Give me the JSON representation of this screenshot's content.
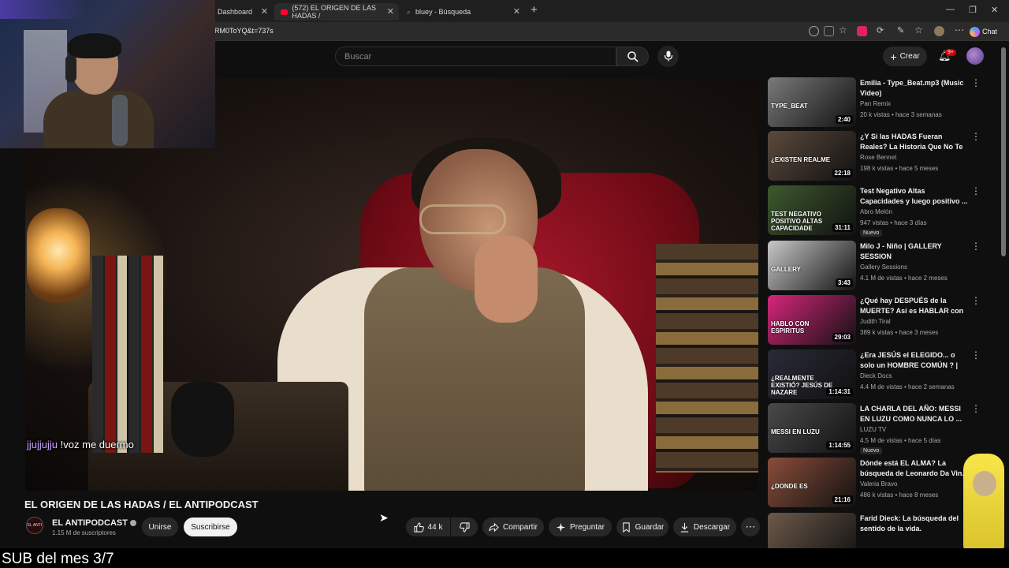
{
  "browser": {
    "tabs": [
      {
        "label": "Dashboard"
      },
      {
        "label": "(572) EL ORIGEN DE LAS HADAS /"
      },
      {
        "label": "bluey - Búsqueda"
      }
    ],
    "url": "RM0ToYQ&t=737s",
    "chat_label": "Chat"
  },
  "header": {
    "search_placeholder": "Buscar",
    "create_label": "Crear",
    "notifications_badge": "9+"
  },
  "player": {
    "chat_user": "jjujjujju",
    "chat_message": "!voz me duermo"
  },
  "video": {
    "title": "EL ORIGEN DE LAS HADAS / EL ANTIPODCAST",
    "channel": "EL ANTIPODCAST",
    "channel_avatar_text": "EL ANTI",
    "subscribers": "1.15 M de suscriptores",
    "join_label": "Unirse",
    "subscribe_label": "Suscribirse",
    "likes": "44 k",
    "share_label": "Compartir",
    "ask_label": "Preguntar",
    "save_label": "Guardar",
    "download_label": "Descargar"
  },
  "recommendations": [
    {
      "title": "Emilia - Type_Beat.mp3 (Music Video)",
      "channel": "Pan Remix",
      "meta": "20 k vistas • hace 3 semanas",
      "duration": "2:40",
      "thumb_color": "#7a7a7a",
      "thumb_text": "TYPE_BEAT"
    },
    {
      "title": "¿Y Si las HADAS Fueran Reales? La Historia Que No Te Contaron",
      "channel": "Rose Bennet",
      "meta": "198 k vistas • hace 5 meses",
      "duration": "22:18",
      "thumb_color": "#5b4a3d",
      "thumb_text": "¿EXISTEN REALME"
    },
    {
      "title": "Test Negativo Altas Capacidades y luego positivo ...",
      "channel": "Abro Melón",
      "meta": "947 vistas • hace 3 días",
      "duration": "31:11",
      "badge": "Nuevo",
      "thumb_color": "#3e5a2e",
      "thumb_text": "TEST NEGATIVO POSITIVO ALTAS CAPACIDADE"
    },
    {
      "title": "Milo J - Niño | GALLERY SESSION",
      "channel": "Gallery Sessions",
      "meta": "4.1 M de vistas • hace 2 meses",
      "duration": "3:43",
      "thumb_color": "#c8c8c8",
      "thumb_text": "GALLERY"
    },
    {
      "title": "¿Qué hay DESPUÉS de la MUERTE? Así es HABLAR con ...",
      "channel": "Judith Tiral",
      "meta": "389 k vistas • hace 3 meses",
      "duration": "29:03",
      "thumb_color": "#d6267a",
      "thumb_text": "HABLO CON ESPIRITUS"
    },
    {
      "title": "¿Era JESÚS el ELEGIDO... o solo un HOMBRE COMÚN ? | Jesús ...",
      "channel": "Dieck Docs",
      "meta": "4.4 M de vistas • hace 2 semanas",
      "duration": "1:14:31",
      "thumb_color": "#2a2a38",
      "thumb_text": "¿REALMENTE EXISTIÓ? JESÚS DE NAZARE"
    },
    {
      "title": "LA CHARLA DEL AÑO: MESSI EN LUZU COMO NUNCA LO ...",
      "channel": "LUZU TV",
      "meta": "4.5 M de vistas • hace 5 días",
      "duration": "1:14:55",
      "badge": "Nuevo",
      "thumb_color": "#4a4a4a",
      "thumb_text": "MESSI EN LUZU"
    },
    {
      "title": "Dónde está EL ALMA? La búsqueda de Leonardo Da Vin...",
      "channel": "Valeria Bravo",
      "meta": "486 k vistas • hace 8 meses",
      "duration": "21:16",
      "thumb_color": "#8a4d3a",
      "thumb_text": "¿DONDE ES"
    },
    {
      "title": "Farid Dieck: La búsqueda del sentido de la vida.",
      "channel": "",
      "meta": "",
      "duration": "",
      "thumb_color": "#6d5a4a",
      "thumb_text": ""
    }
  ],
  "overlay": {
    "sub_text": "SUB del mes 3/7"
  },
  "colors": {
    "background": "#0f0f0f",
    "accent_red": "#ff0033",
    "chat_name": "#c9a4ff"
  }
}
